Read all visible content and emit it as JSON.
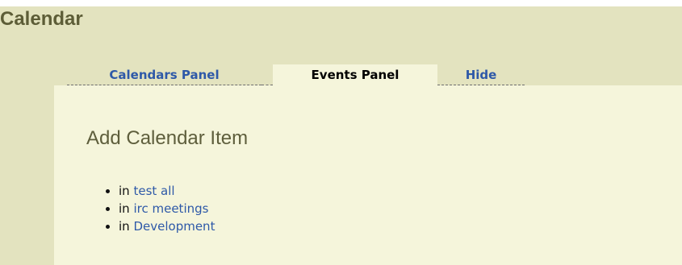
{
  "page": {
    "title": "Calendar"
  },
  "tabs": [
    {
      "label": "Calendars Panel",
      "active": false
    },
    {
      "label": "Events Panel",
      "active": true
    },
    {
      "label": "Hide",
      "active": false
    }
  ],
  "panel": {
    "title": "Add Calendar Item",
    "items": [
      {
        "prefix": "in",
        "link": "test all"
      },
      {
        "prefix": "in",
        "link": "irc meetings"
      },
      {
        "prefix": "in",
        "link": "Development"
      }
    ]
  },
  "colors": {
    "outer_background": "#e3e3bf",
    "panel_background": "#f5f5db",
    "title_text": "#5d5d37",
    "link": "#2e59a8"
  }
}
